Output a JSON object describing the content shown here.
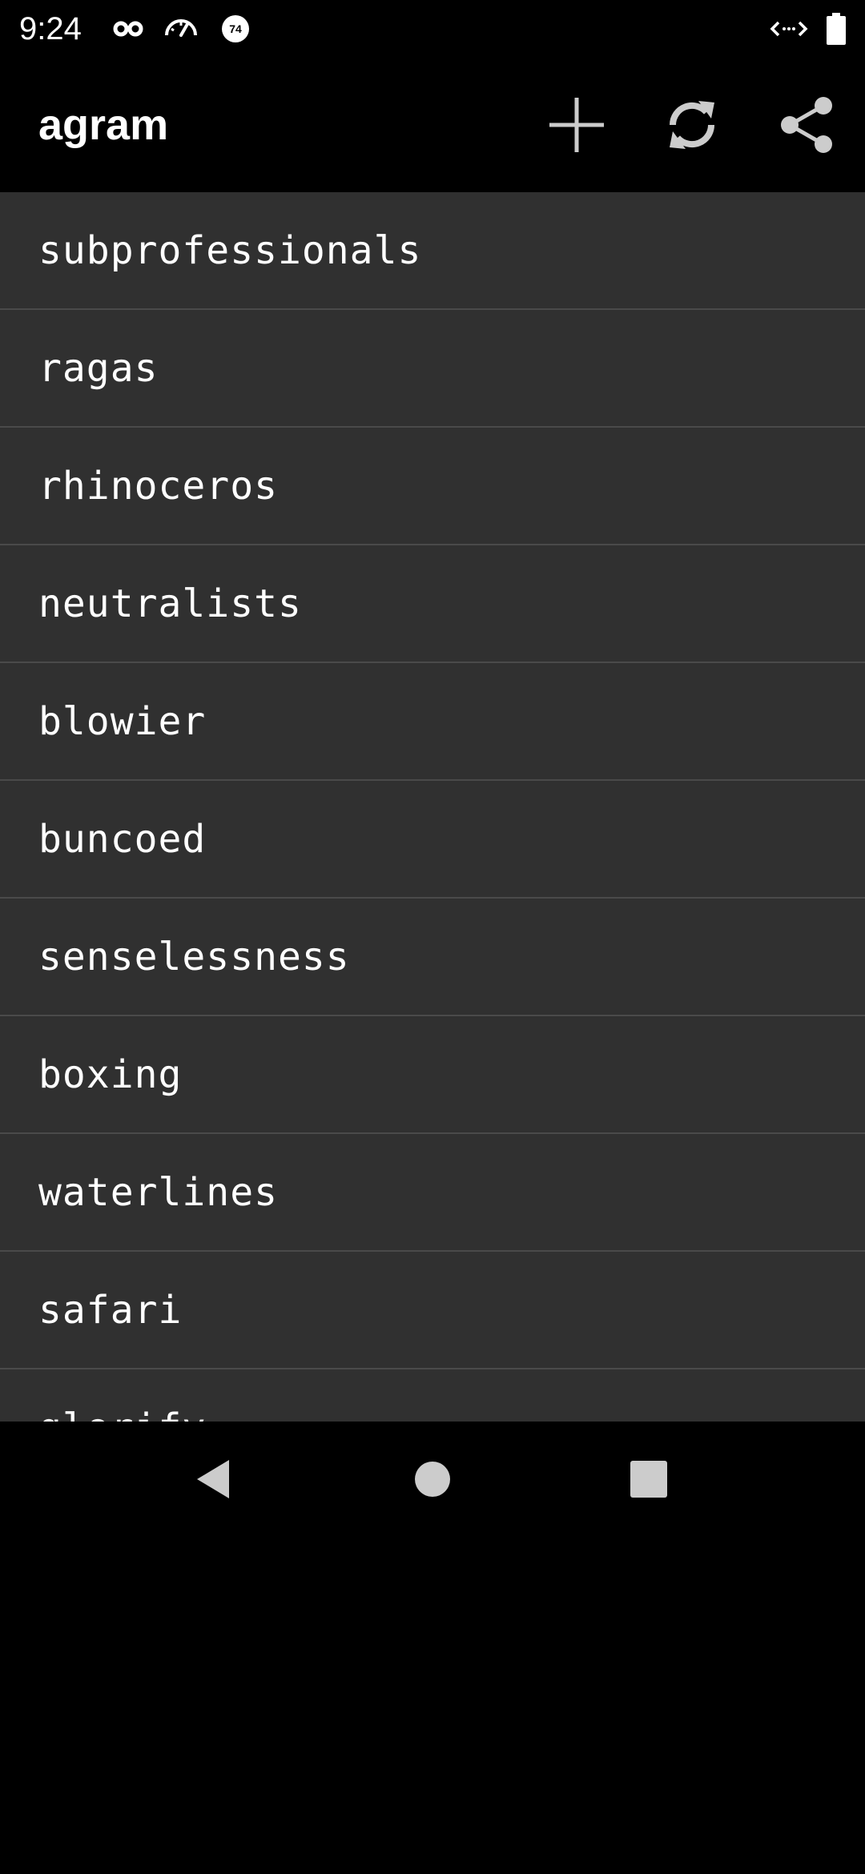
{
  "status_bar": {
    "time": "9:24",
    "icons": [
      "incognito-icon",
      "speedometer-icon",
      "badge-74-icon",
      "code-icon",
      "battery-icon"
    ],
    "badge_number": "74"
  },
  "app_bar": {
    "title": "agram",
    "actions": [
      "add-icon",
      "refresh-icon",
      "share-icon"
    ]
  },
  "words": [
    "subprofessionals",
    "ragas",
    "rhinoceros",
    "neutralists",
    "blowier",
    "buncoed",
    "senselessness",
    "boxing",
    "waterlines",
    "safari",
    "glorify"
  ],
  "nav_bar": {
    "buttons": [
      "back-icon",
      "home-icon",
      "recents-icon"
    ]
  },
  "colors": {
    "background": "#000000",
    "list_background": "#303030",
    "divider": "#4a4a4a",
    "text": "#ffffff",
    "icon": "#cccccc"
  }
}
